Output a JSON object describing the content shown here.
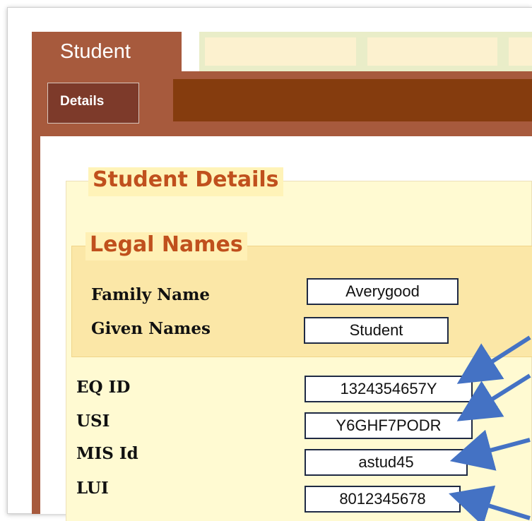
{
  "tabs": {
    "primary_active": "Student"
  },
  "subtabs": {
    "active": "Details"
  },
  "student_details": {
    "legend": "Student Details",
    "legal_names": {
      "legend": "Legal Names",
      "family_name_label": "Family Name",
      "family_name_value": "Averygood",
      "given_names_label": "Given Names",
      "given_names_value": "Student"
    },
    "ids": [
      {
        "label": "EQ ID",
        "value": "1324354657Y"
      },
      {
        "label": "USI",
        "value": "Y6GHF7PODR"
      },
      {
        "label": "MIS Id",
        "value": "astud45"
      },
      {
        "label": "LUI",
        "value": "8012345678"
      }
    ]
  },
  "colors": {
    "tab_active": "#a75a3d",
    "tab_inactive": "#fcf1cf",
    "subtab_bar": "#853c0e",
    "legend_text": "#c0501d",
    "panel_bg": "#fffad2",
    "inner_panel_bg": "#fbe7a7",
    "arrow": "#4472c4"
  },
  "icons": {
    "annotation_arrows": "arrow-icon"
  }
}
